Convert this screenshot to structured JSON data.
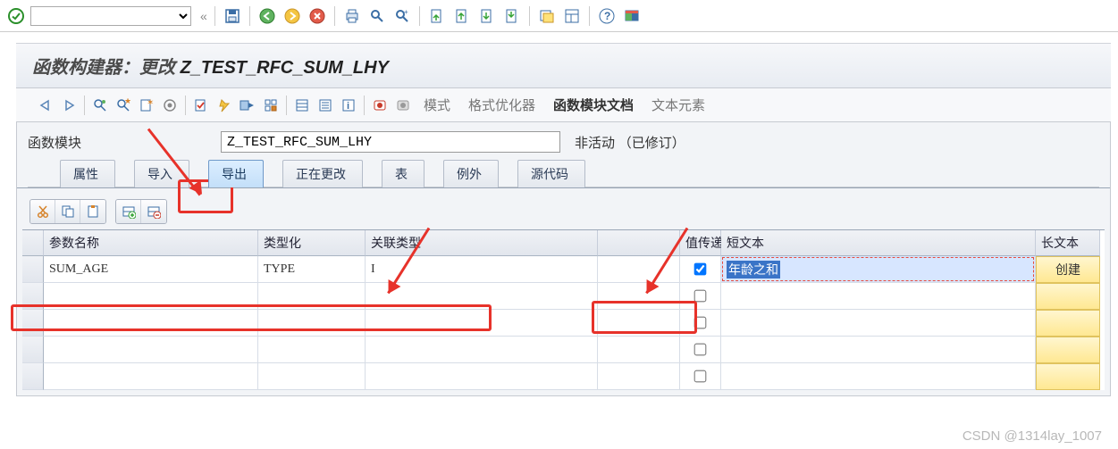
{
  "page_title_label": "函数构建器：更改 ",
  "page_title_name": "Z_TEST_RFC_SUM_LHY",
  "module": {
    "label": "函数模块",
    "value": "Z_TEST_RFC_SUM_LHY",
    "status": "非活动 （已修订）"
  },
  "tabs": {
    "items": [
      {
        "label": "属性"
      },
      {
        "label": "导入"
      },
      {
        "label": "导出"
      },
      {
        "label": "正在更改"
      },
      {
        "label": "表"
      },
      {
        "label": "例外"
      },
      {
        "label": "源代码"
      }
    ],
    "active_index": 2
  },
  "toolbar_text_buttons": {
    "mode": "模式",
    "formatter": "格式优化器",
    "doc": "函数模块文档",
    "textelem": "文本元素"
  },
  "grid": {
    "headers": {
      "param": "参数名称",
      "typing": "类型化",
      "assoc": "关联类型",
      "passval": "值传递",
      "short": "短文本",
      "long": "长文本"
    },
    "rows": [
      {
        "param": "SUM_AGE",
        "typing": "TYPE",
        "assoc": "I",
        "passval": true,
        "short": "年龄之和",
        "long_btn": "创建"
      },
      {
        "param": "",
        "typing": "",
        "assoc": "",
        "passval": false,
        "short": "",
        "long_btn": ""
      },
      {
        "param": "",
        "typing": "",
        "assoc": "",
        "passval": false,
        "short": "",
        "long_btn": ""
      },
      {
        "param": "",
        "typing": "",
        "assoc": "",
        "passval": false,
        "short": "",
        "long_btn": ""
      },
      {
        "param": "",
        "typing": "",
        "assoc": "",
        "passval": false,
        "short": "",
        "long_btn": ""
      }
    ]
  },
  "watermark": "CSDN @1314lay_1007"
}
